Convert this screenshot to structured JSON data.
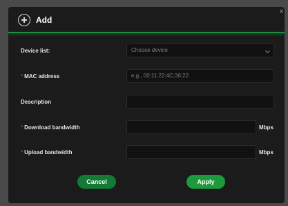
{
  "dialog": {
    "title": "Add",
    "close_glyph": "x"
  },
  "form": {
    "device_list": {
      "label": "Device list:",
      "placeholder": "Choose device"
    },
    "mac_address": {
      "label": "MAC address",
      "required_mark": "*",
      "placeholder": "e.g., 00:11:22:4C:36:22"
    },
    "description": {
      "label": "Description",
      "placeholder": ""
    },
    "download_bandwidth": {
      "label": "Download bandwidth",
      "required_mark": "*",
      "unit": "Mbps"
    },
    "upload_bandwidth": {
      "label": "Upload bandwidth",
      "required_mark": "*",
      "unit": "Mbps"
    }
  },
  "buttons": {
    "cancel": "Cancel",
    "apply": "Apply"
  },
  "colors": {
    "accent": "#1e8e3e",
    "dialog_bg": "#1b1b1b",
    "field_bg": "#111111"
  },
  "icons": {
    "add": "plus-circle-icon",
    "dropdown": "chevron-down-icon",
    "close": "close-icon"
  }
}
